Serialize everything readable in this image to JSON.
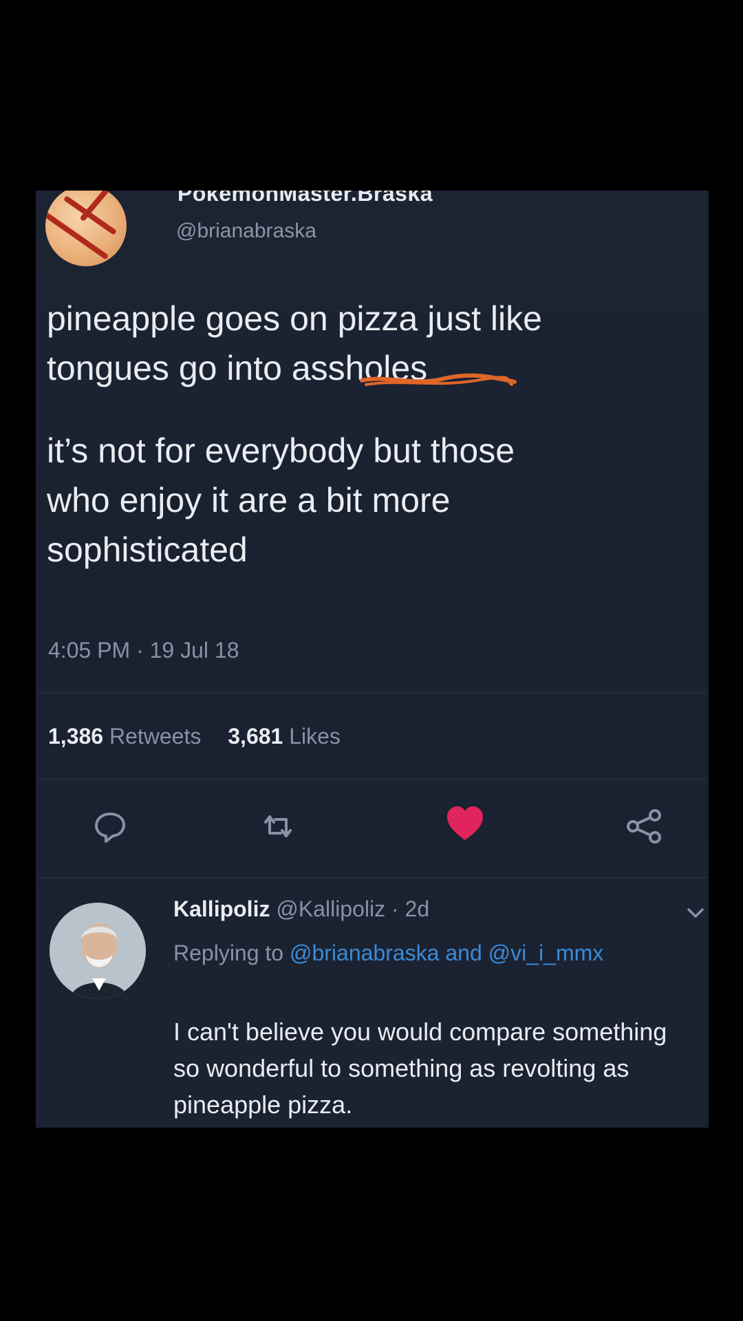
{
  "tweet": {
    "display_name": "PokemonMaster.Braska",
    "handle": "@brianabraska",
    "text_line1": "pineapple goes on pizza just like",
    "text_line2": "tongues go into assholes",
    "text_line3": "it’s not for everybody but those",
    "text_line4": "who enjoy it are a bit more",
    "text_line5": "sophisticated",
    "timestamp": "4:05 PM · 19 Jul 18",
    "retweet_count": "1,386",
    "retweet_label": "Retweets",
    "like_count": "3,681",
    "like_label": "Likes"
  },
  "actions": {
    "reply_icon": "reply-icon",
    "retweet_icon": "retweet-icon",
    "like_icon": "heart-icon",
    "share_icon": "share-icon",
    "liked_color": "#e0245e"
  },
  "reply": {
    "name": "Kallipoliz",
    "handle": "@Kallipoliz",
    "age": "· 2d",
    "replying_prefix": "Replying to",
    "mention1": "@brianabraska",
    "and_word": "and",
    "mention2": "@vi_i_mmx",
    "text": "I can't believe you would compare something so wonderful to something as revolting as pineapple pizza."
  },
  "colors": {
    "background": "#000000",
    "card": "#1b2232",
    "link": "#3b8bd6",
    "annotation": "#e0662a"
  }
}
